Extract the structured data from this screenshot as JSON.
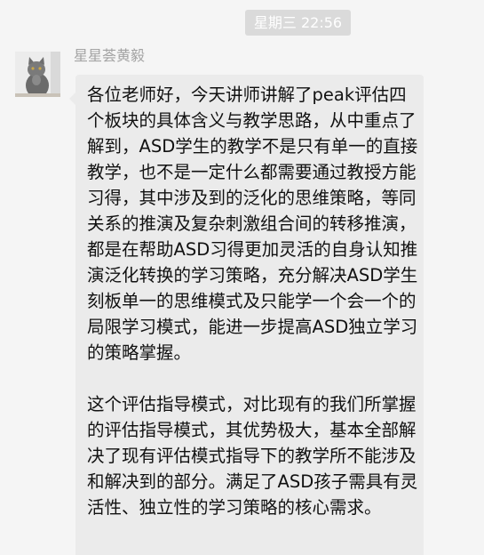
{
  "chat": {
    "timestamp": "星期三 22:56",
    "message": {
      "sender_name": "星星荟黄毅",
      "avatar": "cat-avatar",
      "paragraphs": [
        "各位老师好，今天讲师讲解了peak评估四个板块的具体含义与教学思路，从中重点了解到，ASD学生的教学不是只有单一的直接教学，也不是一定什么都需要通过教授方能习得，其中涉及到的泛化的思维策略，等同关系的推演及复杂刺激组合间的转移推演，都是在帮助ASD习得更加灵活的自身认知推演泛化转换的学习策略，充分解决ASD学生刻板单一的思维模式及只能学一个会一个的局限学习模式，能进一步提高ASD独立学习的策略掌握。",
        "这个评估指导模式，对比现有的我们所掌握的评估指导模式，其优势极大，基本全部解决了现有评估模式指导下的教学所不能涉及和解决到的部分。满足了ASD孩子需具有灵活性、独立性的学习策略的核心需求。"
      ]
    }
  },
  "colors": {
    "background": "#f5f5f5",
    "bubble": "#ebebeb",
    "timestamp_bg": "#dadada",
    "name": "#a3a3a3"
  }
}
